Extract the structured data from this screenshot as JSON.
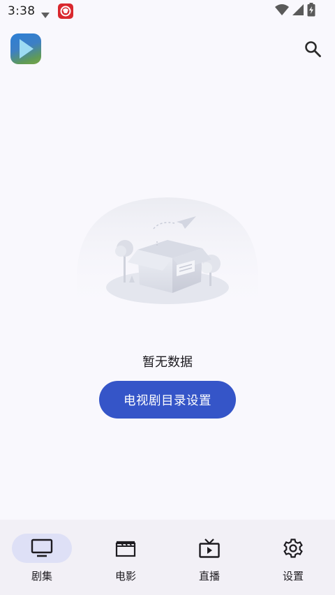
{
  "status_bar": {
    "time": "3:38",
    "icons": [
      "notification-arrow-icon",
      "app-notification-icon",
      "wifi-icon",
      "signal-icon",
      "battery-charging-icon"
    ]
  },
  "app_bar": {
    "logo_icon": "play-icon",
    "search_icon": "search-icon"
  },
  "empty_state": {
    "illustration": "empty-box-illustration",
    "message": "暂无数据",
    "action_label": "电视剧目录设置"
  },
  "bottom_nav": {
    "items": [
      {
        "label": "剧集",
        "icon": "tv-icon",
        "active": true
      },
      {
        "label": "电影",
        "icon": "clapperboard-icon",
        "active": false
      },
      {
        "label": "直播",
        "icon": "live-tv-icon",
        "active": false
      },
      {
        "label": "设置",
        "icon": "gear-icon",
        "active": false
      }
    ]
  },
  "colors": {
    "background": "#f9f8fd",
    "primary": "#3555c8",
    "nav_background": "#f2f0f6",
    "nav_active_pill": "#dee0f6"
  }
}
